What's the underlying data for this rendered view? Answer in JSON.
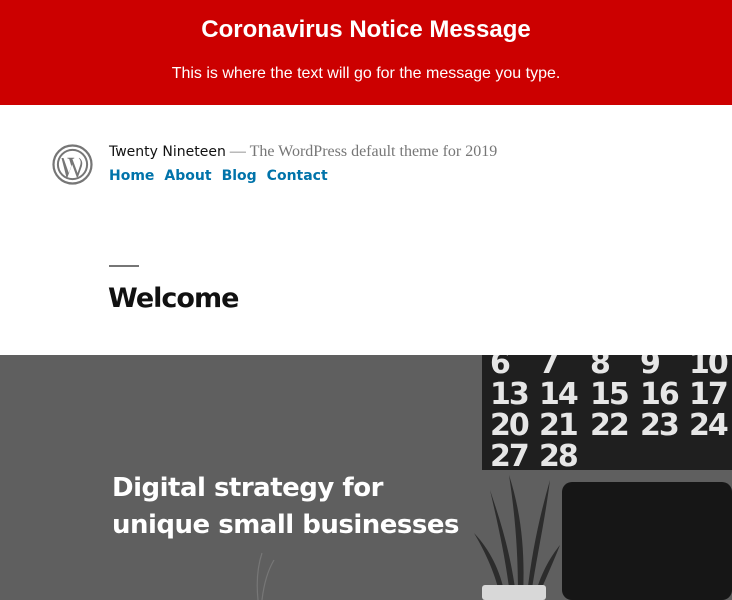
{
  "notice": {
    "title": "Coronavirus Notice Message",
    "text": "This is where the text will go for the message you type.",
    "background_color": "#cc0000"
  },
  "header": {
    "logo_icon": "wordpress-logo-icon",
    "site_title": "Twenty Nineteen",
    "separator": " — ",
    "tagline": "The WordPress default theme for 2019",
    "nav": [
      {
        "label": "Home"
      },
      {
        "label": "About"
      },
      {
        "label": "Blog"
      },
      {
        "label": "Contact"
      }
    ],
    "link_color": "#0073aa"
  },
  "page": {
    "title": "Welcome"
  },
  "hero": {
    "heading": "Digital strategy for\nunique small businesses",
    "calendar_numbers": [
      "6",
      "7",
      "8",
      "9",
      "10",
      "13",
      "14",
      "15",
      "16",
      "17",
      "20",
      "21",
      "22",
      "23",
      "24",
      "27",
      "28"
    ]
  }
}
